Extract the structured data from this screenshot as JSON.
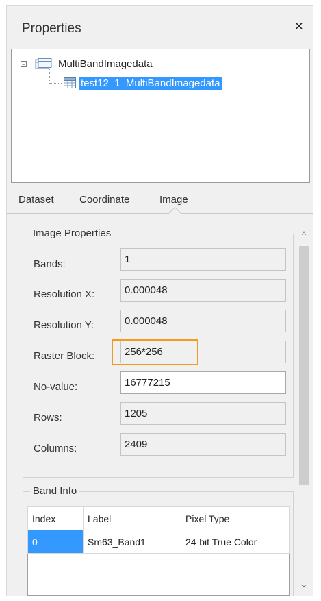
{
  "window": {
    "title": "Properties",
    "close_glyph": "×"
  },
  "tree": {
    "root_label": "MultiBandImagedata",
    "root_expander": "−",
    "child_label": "test12_1_MultiBandImagedata"
  },
  "tabs": [
    {
      "label": "Dataset"
    },
    {
      "label": "Coordinate"
    },
    {
      "label": "Image",
      "active": true
    }
  ],
  "image_properties": {
    "title": "Image Properties",
    "rows": [
      {
        "label": "Bands:",
        "value": "1",
        "editable": false
      },
      {
        "label": "Resolution X:",
        "value": "0.000048",
        "editable": false
      },
      {
        "label": "Resolution Y:",
        "value": "0.000048",
        "editable": false
      },
      {
        "label": "Raster Block:",
        "value": "256*256",
        "editable": false,
        "highlighted": true
      },
      {
        "label": "No-value:",
        "value": "16777215",
        "editable": true
      },
      {
        "label": "Rows:",
        "value": "1205",
        "editable": false
      },
      {
        "label": "Columns:",
        "value": "2409",
        "editable": false
      }
    ]
  },
  "band_info": {
    "title": "Band Info",
    "columns": [
      "Index",
      "Label",
      "Pixel Type"
    ],
    "rows": [
      [
        "0",
        "Sm63_Band1",
        "24-bit True Color"
      ]
    ]
  },
  "scrollbar": {
    "up_glyph": "^",
    "down_glyph": "⌄"
  },
  "colors": {
    "selection": "#3399ff",
    "highlight_box": "#f39a21",
    "panel_bg": "#f0f0f0"
  }
}
